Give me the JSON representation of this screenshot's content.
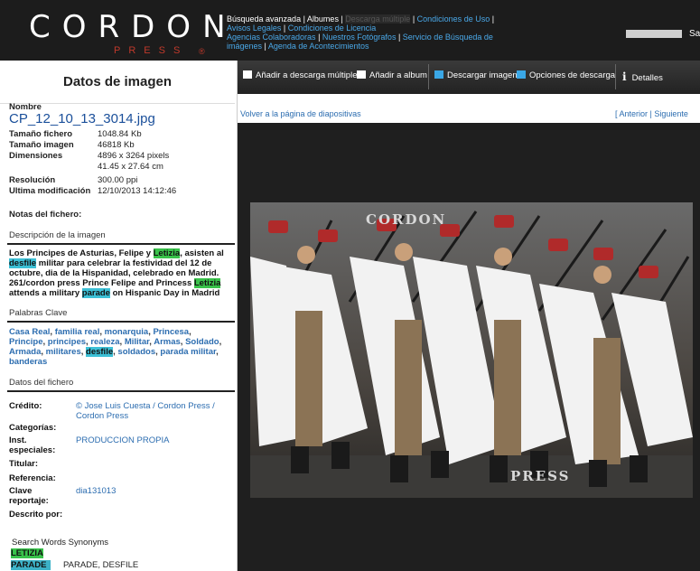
{
  "header": {
    "logo_main": "CORDON",
    "logo_sub": "PRESS",
    "logo_mark": "®",
    "nav": {
      "busqueda": "Búsqueda avanzada",
      "albumes": "Albumes",
      "descarga": "Descarga múltiple",
      "condiciones_uso": "Condiciones de Uso",
      "avisos": "Avisos Legales",
      "condiciones_licencia": "Condiciones de Licencia",
      "agencias": "Agencias Colaboradoras",
      "fotografos": "Nuestros Fotógrafos",
      "servicio": "Servicio de Búsqueda de imágenes",
      "agenda": "Agenda de Acontecimientos"
    },
    "user_text": "Sa"
  },
  "left": {
    "title": "Datos de imagen",
    "nombre_label": "Nombre",
    "filename": "CP_12_10_13_3014.jpg",
    "meta": [
      {
        "k": "Tamaño fichero",
        "v": "1048.84 Kb"
      },
      {
        "k": "Tamaño imagen",
        "v": "46818 Kb"
      },
      {
        "k": "Dimensiones",
        "v": "4896 x 3264 pixels"
      },
      {
        "k": "",
        "v": "41.45 x 27.64 cm"
      },
      {
        "k": "Resolución",
        "v": "300.00 ppi"
      },
      {
        "k": "Ultima modificación",
        "v": "12/10/2013 14:12:46"
      }
    ],
    "notas_label": "Notas del fichero:",
    "descripcion_label": "Descripción de la imagen",
    "desc": {
      "p1": "Los Principes de Asturias, Felipe y ",
      "h1": "Letizia",
      "p2": ", asisten al ",
      "h2": "desfile",
      "p3": " militar para celebrar la festividad del 12 de octubre, dia de la Hispanidad, celebrado en Madrid. 261/cordon press Prince Felipe and Princess ",
      "h3": "Letizia",
      "p4": " attends a military ",
      "h4": "parade",
      "p5": " on Hispanic Day in Madrid"
    },
    "palabras_label": "Palabras Clave",
    "keywords": [
      "Casa Real",
      "familia real",
      "monarquia",
      "Princesa",
      "Principe",
      "principes",
      "realeza",
      "Militar",
      "Armas",
      "Soldado",
      "Armada",
      "militares",
      "desfile",
      "soldados",
      "parada militar",
      "banderas"
    ],
    "datos_label": "Datos del fichero",
    "credito_label": "Crédito:",
    "credito_value": "© Jose Luis Cuesta / Cordon Press / Cordon Press",
    "categorias_label": "Categorías:",
    "inst_label": "Inst. especiales:",
    "inst_value": "PRODUCCION PROPIA",
    "titular_label": "Titular:",
    "referencia_label": "Referencia:",
    "clave_label": "Clave reportaje:",
    "clave_value": "dia131013",
    "descrito_label": "Descrito por:",
    "synonyms_label": "Search Words Synonyms",
    "syn_letizia": "LETIZIA",
    "syn_parade": "PARADE",
    "syn_parade_value": "PARADE, DESFILE"
  },
  "toolbar": {
    "add_multi": "Añadir a descarga múltiple",
    "add_album": "Añadir a album",
    "download": "Descargar imagen",
    "options": "Opciones de descarga",
    "details": "Detalles"
  },
  "subbar": {
    "back": "Volver a la página de diapositivas",
    "nav": "[ Anterior | Siguiente"
  },
  "photo": {
    "watermark_top": "CORDON",
    "watermark_bottom": "PRESS"
  },
  "colors": {
    "header_bg": "#1c1c1c",
    "link_blue": "#2c6db0",
    "highlight_green": "#39c24a",
    "highlight_cyan": "#3cc0d6",
    "logo_red": "#c0392b"
  }
}
